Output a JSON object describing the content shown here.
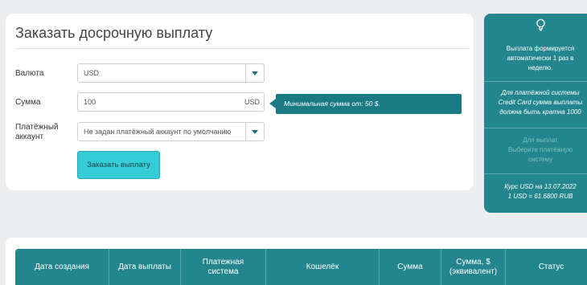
{
  "form": {
    "title": "Заказать досрочную выплату",
    "currency_label": "Валюта",
    "currency_value": "USD",
    "amount_label": "Сумма",
    "amount_value": "100",
    "amount_suffix": "USD",
    "account_label_line1": "Платёжный",
    "account_label_line2": "аккаунт",
    "account_value": "Не задан платёжный аккаунт по умолчанию",
    "submit_label": "Заказать выплату"
  },
  "tooltip": {
    "text": "Минимальная сумма от: 50 $."
  },
  "info": {
    "icon": "lightbulb-icon",
    "line1": "Выплата формируется",
    "line2": "автоматически 1 раз в",
    "line3": "неделю.",
    "cc_line1": "Для платёжной системы",
    "cc_line2": "Credit Card сумма выплаты",
    "cc_line3": "должна быть кратна 1000",
    "ps_line1": "Для выплат",
    "ps_line2": "Выберите платёжную",
    "ps_line3": "систему",
    "rate_line1": "Курс USD на 13.07.2022",
    "rate_line2": "1 USD = 61.6800 RUB"
  },
  "table": {
    "headers": [
      {
        "line1": "Дата создания",
        "line2": ""
      },
      {
        "line1": "Дата выплаты",
        "line2": ""
      },
      {
        "line1": "Платежная",
        "line2": "система"
      },
      {
        "line1": "Кошелёк",
        "line2": ""
      },
      {
        "line1": "Сумма",
        "line2": ""
      },
      {
        "line1": "Сумма, $",
        "line2": "(эквивалент)"
      },
      {
        "line1": "Статус",
        "line2": ""
      }
    ]
  },
  "colors": {
    "accent": "#23858d",
    "button": "#35cbd7",
    "background": "#eceeef"
  }
}
